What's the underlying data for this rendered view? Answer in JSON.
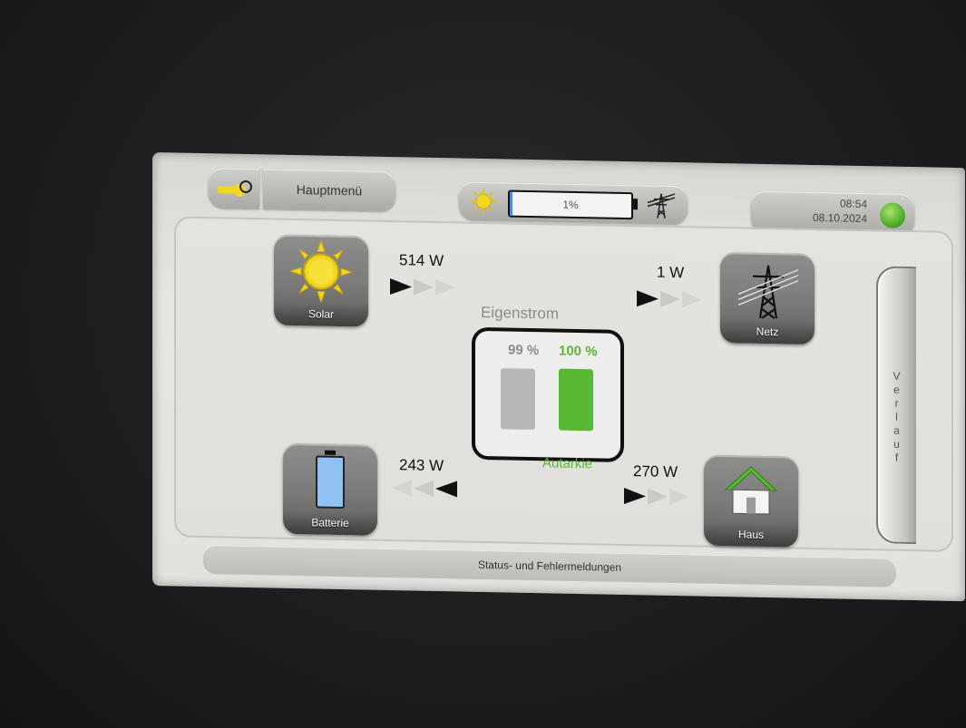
{
  "header": {
    "menu_label": "Hauptmenü",
    "battery_status_label": "1%",
    "battery_level_fraction": 0.01,
    "time": "08:54",
    "date": "08.10.2024"
  },
  "flows": {
    "solar": {
      "label": "Solar",
      "power": "514 W"
    },
    "netz": {
      "label": "Netz",
      "power": "1 W"
    },
    "batterie": {
      "label": "Batterie",
      "power": "243 W"
    },
    "haus": {
      "label": "Haus",
      "power": "270 W"
    }
  },
  "eigenstrom": {
    "title": "Eigenstrom",
    "eigenverbrauch_label": "99 %",
    "eigenverbrauch_value": 99,
    "autarkie_label": "100 %",
    "autarkie_value": 100,
    "autarkie_caption": "Autarkie"
  },
  "verlauf_label": "Verlauf",
  "status_bar_label": "Status- und Fehlermeldungen",
  "colors": {
    "accent_green": "#59b832",
    "sun_yellow": "#f2d720",
    "battery_blue": "#8fc2f2",
    "eigen_grey": "#b7b7b5"
  },
  "icons": [
    "key-icon",
    "sun-icon",
    "power-tower-icon",
    "globe-icon",
    "battery-icon",
    "house-icon"
  ]
}
